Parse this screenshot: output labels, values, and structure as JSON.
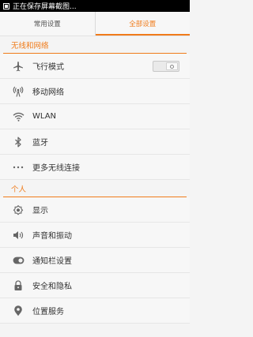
{
  "status_bar": {
    "text": "正在保存屏幕截图..."
  },
  "tabs": [
    {
      "label": "常用设置",
      "active": false
    },
    {
      "label": "全部设置",
      "active": true
    }
  ],
  "sections": {
    "wireless": "无线和网络",
    "personal": "个人"
  },
  "items": {
    "airplane": {
      "label": "飞行模式",
      "icon": "airplane-icon",
      "toggle": "off"
    },
    "mobile": {
      "label": "移动网络",
      "icon": "signal-tower-icon"
    },
    "wlan": {
      "label": "WLAN",
      "icon": "wifi-icon"
    },
    "bluetooth": {
      "label": "蓝牙",
      "icon": "bluetooth-icon"
    },
    "more_wireless": {
      "label": "更多无线连接",
      "icon": "more-dots-icon"
    },
    "display": {
      "label": "显示",
      "icon": "brightness-icon"
    },
    "sound": {
      "label": "声音和振动",
      "icon": "speaker-icon"
    },
    "notification": {
      "label": "通知栏设置",
      "icon": "notification-icon"
    },
    "security": {
      "label": "安全和隐私",
      "icon": "lock-icon"
    },
    "location": {
      "label": "位置服务",
      "icon": "location-pin-icon"
    }
  },
  "colors": {
    "accent": "#f07b1a",
    "background": "#f4f4f4",
    "icon": "#666666"
  }
}
